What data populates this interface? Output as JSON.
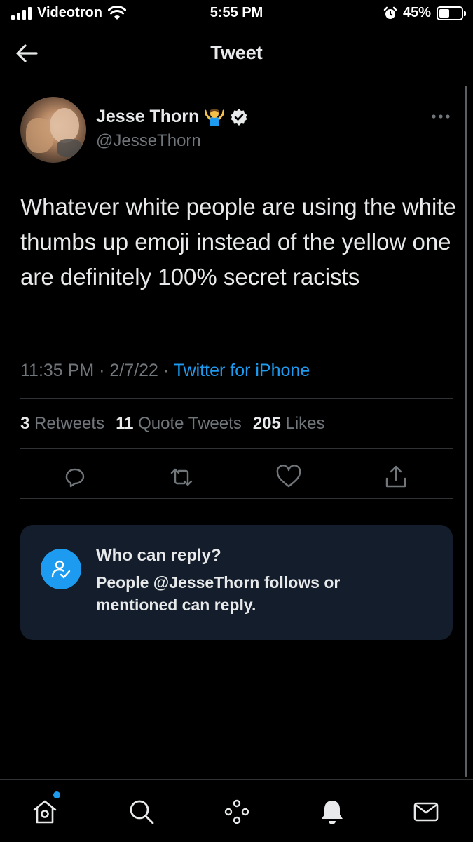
{
  "status_bar": {
    "carrier": "Videotron",
    "time": "5:55 PM",
    "battery_percent": "45%",
    "battery_level": 0.45
  },
  "header": {
    "title": "Tweet"
  },
  "tweet": {
    "display_name": "Jesse Thorn",
    "handle": "@JesseThorn",
    "text": "Whatever white people are using the white thumbs up emoji instead of the yellow one are definitely 100% secret racists",
    "time": "11:35 PM",
    "date": "2/7/22",
    "source": "Twitter for iPhone",
    "separator": "·",
    "stats": {
      "retweets_count": "3",
      "retweets_label": "Retweets",
      "quote_tweets_count": "11",
      "quote_tweets_label": "Quote Tweets",
      "likes_count": "205",
      "likes_label": "Likes"
    }
  },
  "reply_restriction": {
    "title": "Who can reply?",
    "body": "People @JesseThorn follows or mentioned can reply."
  },
  "icons": {
    "accent_color": "#1d9bf0",
    "muted_color": "#71767b"
  }
}
